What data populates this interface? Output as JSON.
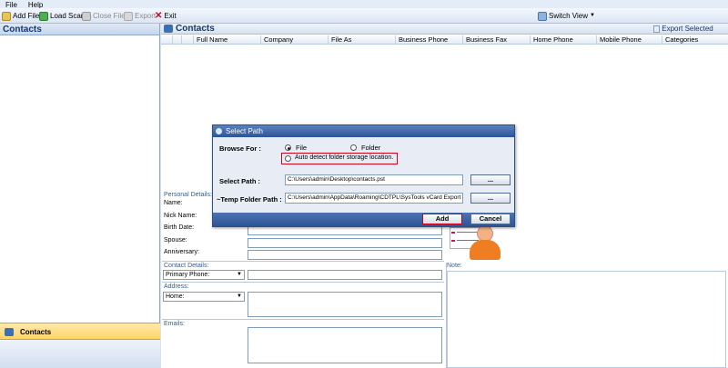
{
  "menu": {
    "file": "File",
    "help": "Help"
  },
  "toolbar": {
    "add_file": "Add File",
    "load_scan": "Load Scan",
    "close_file": "Close File",
    "export": "Export",
    "exit": "Exit",
    "switch_view": "Switch View"
  },
  "left_panel": {
    "title": "Contacts",
    "nav_item": "Contacts"
  },
  "main": {
    "title": "Contacts",
    "export_selected": "Export Selected",
    "columns": [
      "Full Name",
      "Company",
      "File As",
      "Business Phone",
      "Business Fax",
      "Home Phone",
      "Mobile Phone",
      "Categories"
    ]
  },
  "details": {
    "personal_section": "Personal Details:",
    "name": "Name:",
    "nick_name": "Nick Name:",
    "birth_date": "Birth Date:",
    "spouse": "Spouse:",
    "anniversary": "Anniversary:",
    "contact_section": "Contact Details:",
    "phone_select": "Primary Phone:",
    "address_section": "Address:",
    "address_select": "Home:",
    "emails_section": "Emails:",
    "note_label": "Note:"
  },
  "dialog": {
    "title": "Select Path",
    "browse_for": "Browse For :",
    "file_option": "File",
    "folder_option": "Folder",
    "auto_detect": "Auto detect folder storage location.",
    "select_path_label": "Select Path :",
    "select_path_value": "C:\\Users\\admin\\Desktop\\contacts.pst",
    "temp_label": "~Temp Folder Path :",
    "temp_value": "C:\\Users\\admin\\AppData\\Roaming\\CDTPL\\SysTools  vCard Export",
    "browse_btn": "...",
    "add_btn": "Add",
    "cancel_btn": "Cancel"
  },
  "colors": {
    "accent": "#2c5596",
    "highlight_red": "#d0021b",
    "nav_active": "#ffd46a"
  }
}
